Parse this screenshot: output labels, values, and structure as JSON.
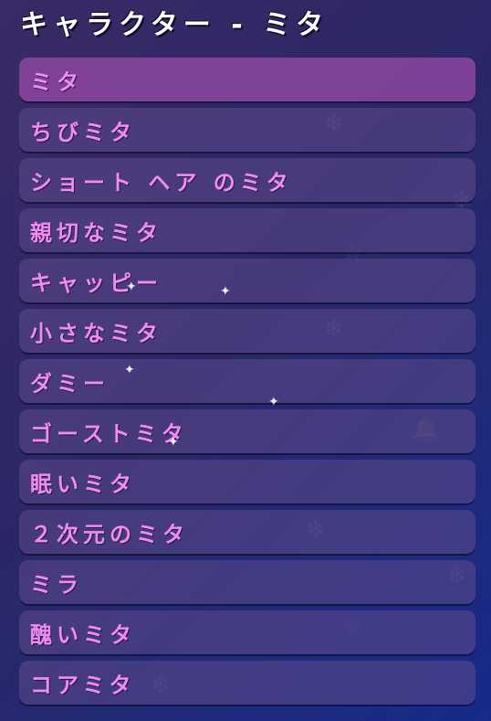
{
  "header": {
    "title": "キャラクター - ミタ"
  },
  "characters": [
    {
      "label": "ミタ",
      "selected": true
    },
    {
      "label": "ちびミタ",
      "selected": false
    },
    {
      "label": "ショート ヘア のミタ",
      "selected": false
    },
    {
      "label": "親切なミタ",
      "selected": false
    },
    {
      "label": "キャッピー",
      "selected": false
    },
    {
      "label": "小さなミタ",
      "selected": false
    },
    {
      "label": "ダミー",
      "selected": false
    },
    {
      "label": "ゴーストミタ",
      "selected": false
    },
    {
      "label": "眠いミタ",
      "selected": false
    },
    {
      "label": "２次元のミタ",
      "selected": false
    },
    {
      "label": "ミラ",
      "selected": false
    },
    {
      "label": "醜いミタ",
      "selected": false
    },
    {
      "label": "コアミタ",
      "selected": false
    }
  ],
  "colors": {
    "item_text": "#ef8cf2",
    "selected_background": "#8c46a0",
    "title_text": "#ffffff"
  }
}
